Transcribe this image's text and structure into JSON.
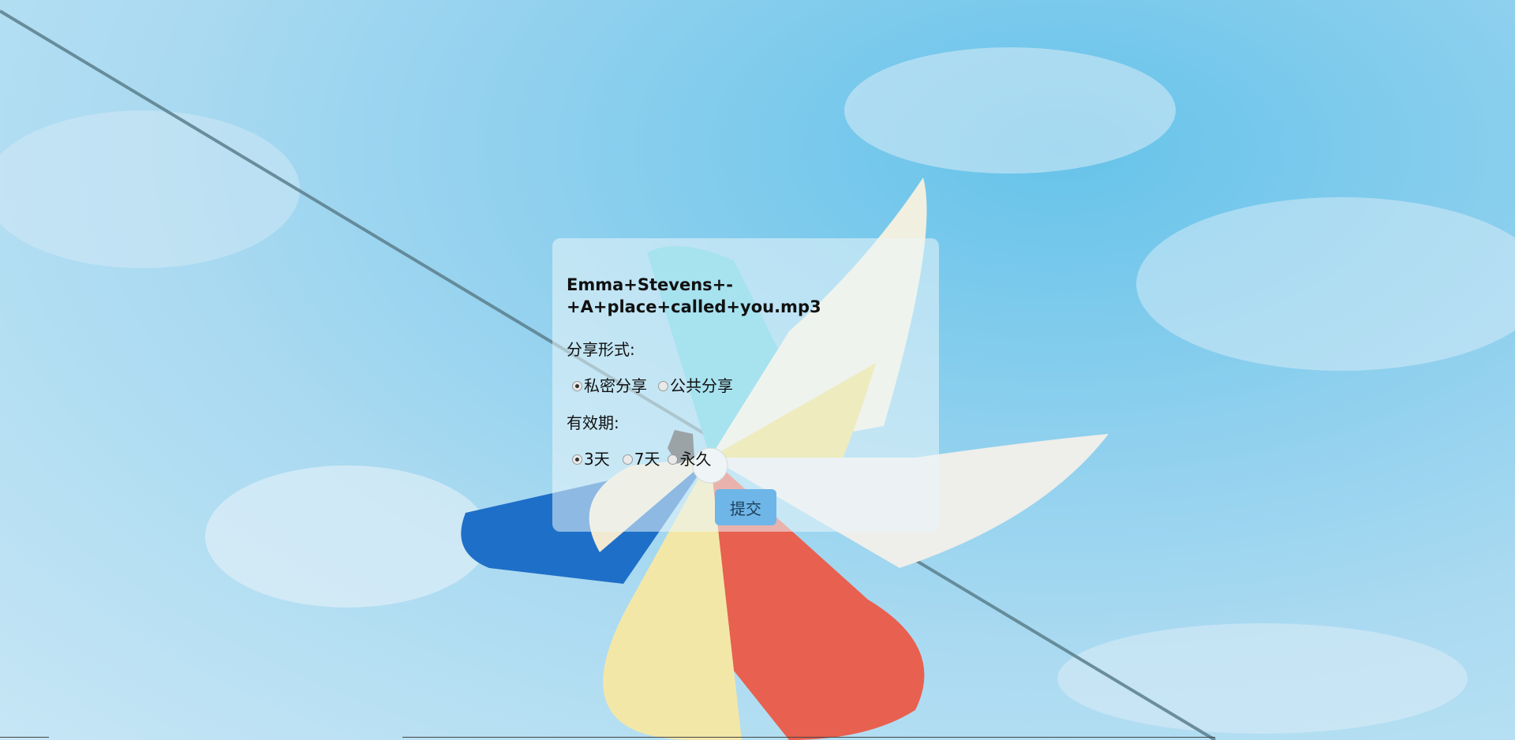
{
  "file": {
    "name": "Emma+Stevens+-\n+A+place+called+you.mp3"
  },
  "share_type": {
    "label": "分享形式:",
    "options": [
      {
        "label": "私密分享",
        "checked": true
      },
      {
        "label": "公共分享",
        "checked": false
      }
    ]
  },
  "validity": {
    "label": "有效期:",
    "options": [
      {
        "label": "3天",
        "checked": true
      },
      {
        "label": "7天",
        "checked": false
      },
      {
        "label": "永久",
        "checked": false
      }
    ]
  },
  "submit": {
    "label": "提交"
  },
  "colors": {
    "panel_bg": "rgba(235,245,250,0.55)",
    "button_bg": "#6fb6e8",
    "sky": "#8fd0ee"
  },
  "background": {
    "icon": "pinwheel-icon"
  }
}
